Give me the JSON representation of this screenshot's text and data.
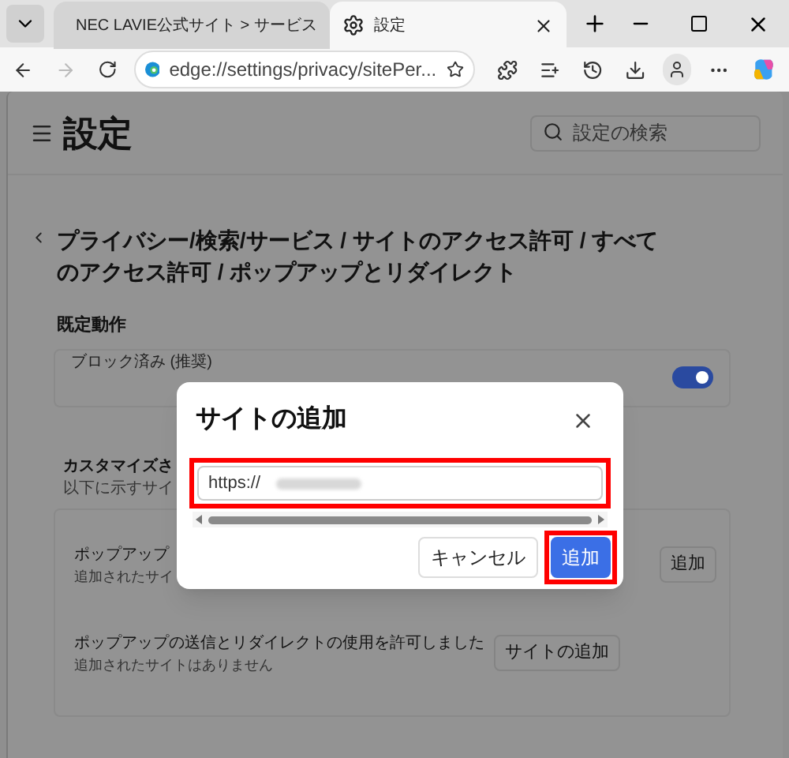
{
  "tabs": [
    {
      "kind": "web",
      "title": "NEC LAVIE公式サイト > サービス",
      "selected": false
    },
    {
      "kind": "settings",
      "title": "設定",
      "selected": true
    }
  ],
  "address_bar": {
    "url": "edge://settings/privacy/sitePer..."
  },
  "settings": {
    "title": "設定",
    "search": {
      "placeholder": "設定の検索"
    },
    "breadcrumb": "プライバシー/検索/サービス / サイトのアクセス許可 / すべてのアクセス許可 / ポップアップとリダイレクト",
    "default_section": {
      "heading": "既定動作",
      "toggle": {
        "label": "ブロック済み (推奨)",
        "on": true
      }
    },
    "custom_section": {
      "heading": "カスタマイズさ",
      "description": "以下に示すサイ",
      "rows": [
        {
          "label": "ポップアップ",
          "sub": "追加されたサイ",
          "button": "追加"
        },
        {
          "label": "ポップアップの送信とリダイレクトの使用を許可しました",
          "sub": "追加されたサイトはありません",
          "button": "サイトの追加"
        }
      ]
    }
  },
  "dialog": {
    "title": "サイトの追加",
    "input": {
      "value": "https://",
      "redacted": true
    },
    "buttons": [
      {
        "kind": "secondary",
        "label": "キャンセル"
      },
      {
        "kind": "primary",
        "label": "追加"
      }
    ]
  }
}
